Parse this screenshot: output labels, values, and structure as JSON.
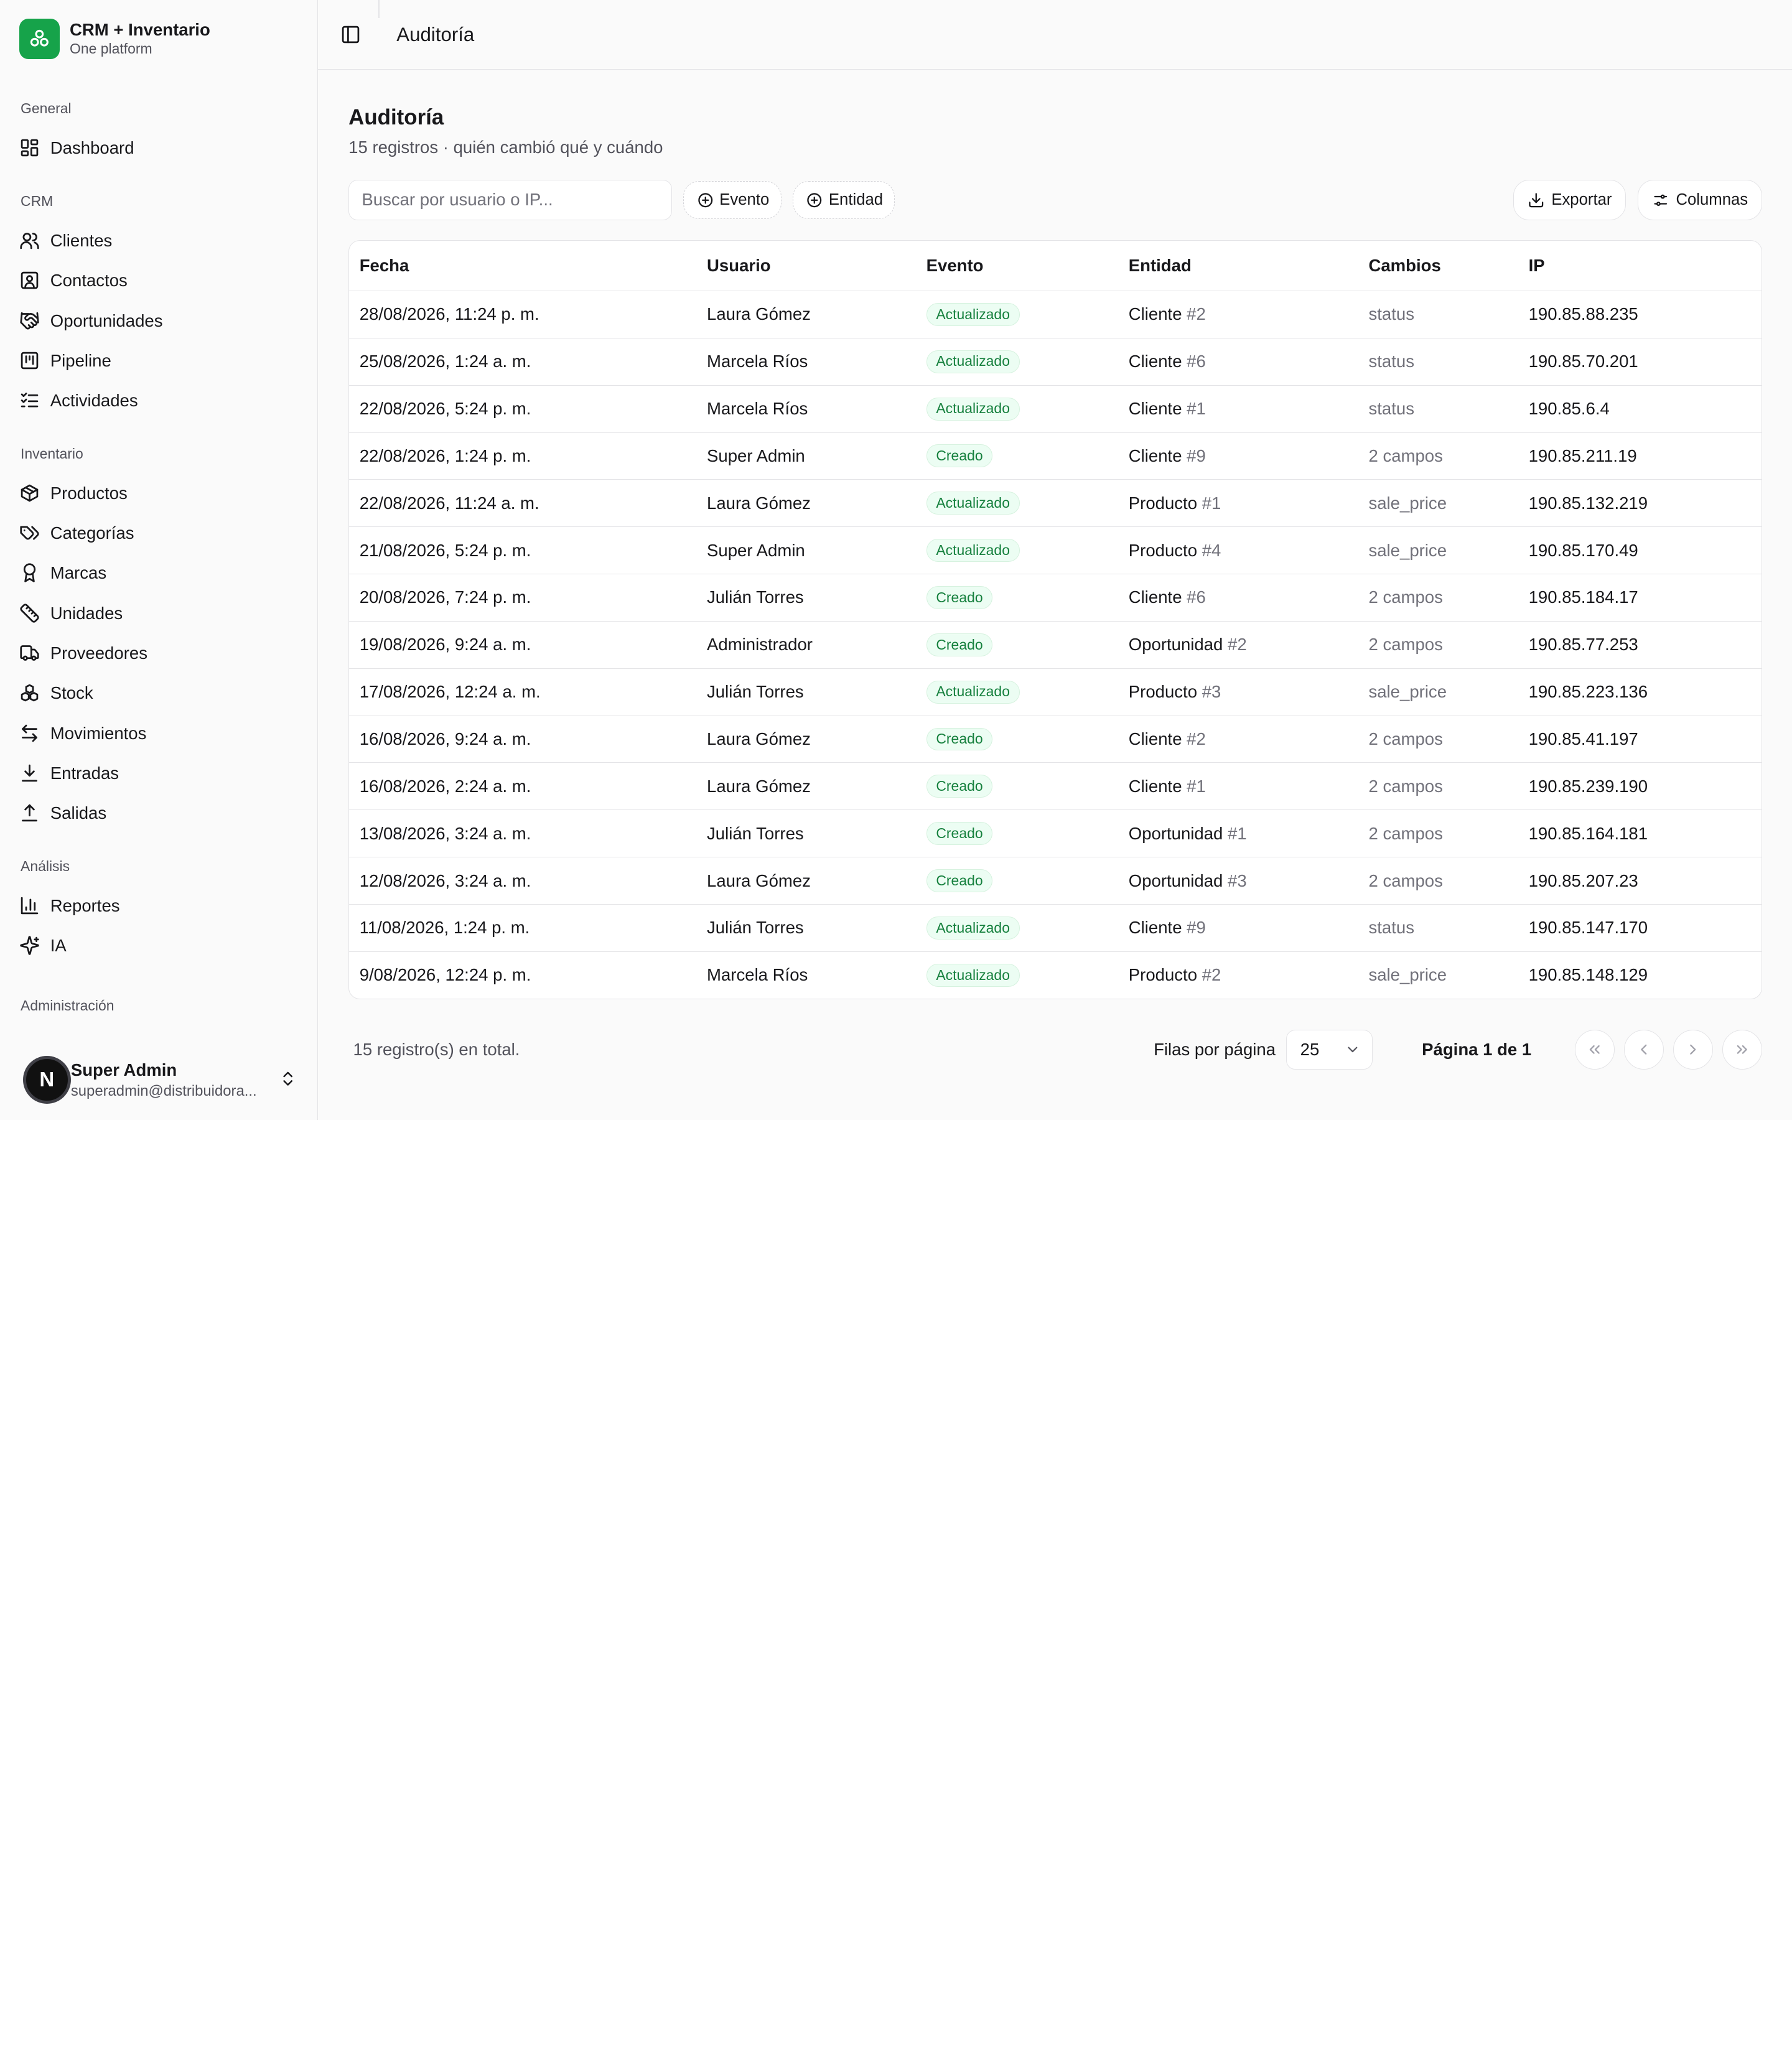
{
  "brand": {
    "title": "CRM + Inventario",
    "subtitle": "One platform"
  },
  "sidebar": {
    "sections": [
      {
        "label": "General",
        "items": [
          {
            "label": "Dashboard",
            "icon": "dashboard-icon"
          }
        ]
      },
      {
        "label": "CRM",
        "items": [
          {
            "label": "Clientes",
            "icon": "users-icon"
          },
          {
            "label": "Contactos",
            "icon": "contact-card-icon"
          },
          {
            "label": "Oportunidades",
            "icon": "handshake-icon"
          },
          {
            "label": "Pipeline",
            "icon": "kanban-icon"
          },
          {
            "label": "Actividades",
            "icon": "checklist-icon"
          }
        ]
      },
      {
        "label": "Inventario",
        "items": [
          {
            "label": "Productos",
            "icon": "package-icon"
          },
          {
            "label": "Categorías",
            "icon": "tags-icon"
          },
          {
            "label": "Marcas",
            "icon": "award-icon"
          },
          {
            "label": "Unidades",
            "icon": "ruler-icon"
          },
          {
            "label": "Proveedores",
            "icon": "truck-icon"
          },
          {
            "label": "Stock",
            "icon": "boxes-icon"
          },
          {
            "label": "Movimientos",
            "icon": "arrows-left-right-icon"
          },
          {
            "label": "Entradas",
            "icon": "download-icon"
          },
          {
            "label": "Salidas",
            "icon": "upload-icon"
          }
        ]
      },
      {
        "label": "Análisis",
        "items": [
          {
            "label": "Reportes",
            "icon": "bar-chart-icon"
          },
          {
            "label": "IA",
            "icon": "sparkles-icon"
          }
        ]
      },
      {
        "label": "Administración",
        "items": []
      }
    ],
    "user": {
      "initial": "N",
      "name": "Super Admin",
      "email": "superadmin@distribuidora..."
    }
  },
  "topbar": {
    "title": "Auditoría"
  },
  "page": {
    "title": "Auditoría",
    "subtitle": "15 registros · quién cambió qué y cuándo"
  },
  "toolbar": {
    "search_placeholder": "Buscar por usuario o IP...",
    "filter_event": "Evento",
    "filter_entity": "Entidad",
    "export_label": "Exportar",
    "columns_label": "Columnas"
  },
  "table": {
    "headers": [
      "Fecha",
      "Usuario",
      "Evento",
      "Entidad",
      "Cambios",
      "IP"
    ],
    "rows": [
      {
        "date": "28/08/2026, 11:24 p. m.",
        "user": "Laura Gómez",
        "event": "Actualizado",
        "entity": "Cliente",
        "entity_id": "#2",
        "changes": "status",
        "ip": "190.85.88.235"
      },
      {
        "date": "25/08/2026, 1:24 a. m.",
        "user": "Marcela Ríos",
        "event": "Actualizado",
        "entity": "Cliente",
        "entity_id": "#6",
        "changes": "status",
        "ip": "190.85.70.201"
      },
      {
        "date": "22/08/2026, 5:24 p. m.",
        "user": "Marcela Ríos",
        "event": "Actualizado",
        "entity": "Cliente",
        "entity_id": "#1",
        "changes": "status",
        "ip": "190.85.6.4"
      },
      {
        "date": "22/08/2026, 1:24 p. m.",
        "user": "Super Admin",
        "event": "Creado",
        "entity": "Cliente",
        "entity_id": "#9",
        "changes": "2 campos",
        "ip": "190.85.211.19"
      },
      {
        "date": "22/08/2026, 11:24 a. m.",
        "user": "Laura Gómez",
        "event": "Actualizado",
        "entity": "Producto",
        "entity_id": "#1",
        "changes": "sale_price",
        "ip": "190.85.132.219"
      },
      {
        "date": "21/08/2026, 5:24 p. m.",
        "user": "Super Admin",
        "event": "Actualizado",
        "entity": "Producto",
        "entity_id": "#4",
        "changes": "sale_price",
        "ip": "190.85.170.49"
      },
      {
        "date": "20/08/2026, 7:24 p. m.",
        "user": "Julián Torres",
        "event": "Creado",
        "entity": "Cliente",
        "entity_id": "#6",
        "changes": "2 campos",
        "ip": "190.85.184.17"
      },
      {
        "date": "19/08/2026, 9:24 a. m.",
        "user": "Administrador",
        "event": "Creado",
        "entity": "Oportunidad",
        "entity_id": "#2",
        "changes": "2 campos",
        "ip": "190.85.77.253"
      },
      {
        "date": "17/08/2026, 12:24 a. m.",
        "user": "Julián Torres",
        "event": "Actualizado",
        "entity": "Producto",
        "entity_id": "#3",
        "changes": "sale_price",
        "ip": "190.85.223.136"
      },
      {
        "date": "16/08/2026, 9:24 a. m.",
        "user": "Laura Gómez",
        "event": "Creado",
        "entity": "Cliente",
        "entity_id": "#2",
        "changes": "2 campos",
        "ip": "190.85.41.197"
      },
      {
        "date": "16/08/2026, 2:24 a. m.",
        "user": "Laura Gómez",
        "event": "Creado",
        "entity": "Cliente",
        "entity_id": "#1",
        "changes": "2 campos",
        "ip": "190.85.239.190"
      },
      {
        "date": "13/08/2026, 3:24 a. m.",
        "user": "Julián Torres",
        "event": "Creado",
        "entity": "Oportunidad",
        "entity_id": "#1",
        "changes": "2 campos",
        "ip": "190.85.164.181"
      },
      {
        "date": "12/08/2026, 3:24 a. m.",
        "user": "Laura Gómez",
        "event": "Creado",
        "entity": "Oportunidad",
        "entity_id": "#3",
        "changes": "2 campos",
        "ip": "190.85.207.23"
      },
      {
        "date": "11/08/2026, 1:24 p. m.",
        "user": "Julián Torres",
        "event": "Actualizado",
        "entity": "Cliente",
        "entity_id": "#9",
        "changes": "status",
        "ip": "190.85.147.170"
      },
      {
        "date": "9/08/2026, 12:24 p. m.",
        "user": "Marcela Ríos",
        "event": "Actualizado",
        "entity": "Producto",
        "entity_id": "#2",
        "changes": "sale_price",
        "ip": "190.85.148.129"
      }
    ]
  },
  "footer": {
    "total": "15 registro(s) en total.",
    "rows_per_page_label": "Filas por página",
    "rows_per_page_value": "25",
    "page_label": "Página 1 de 1"
  },
  "colors": {
    "accent": "#16a34a",
    "badge_text": "#15803d",
    "badge_bg": "#ecfdf3"
  }
}
